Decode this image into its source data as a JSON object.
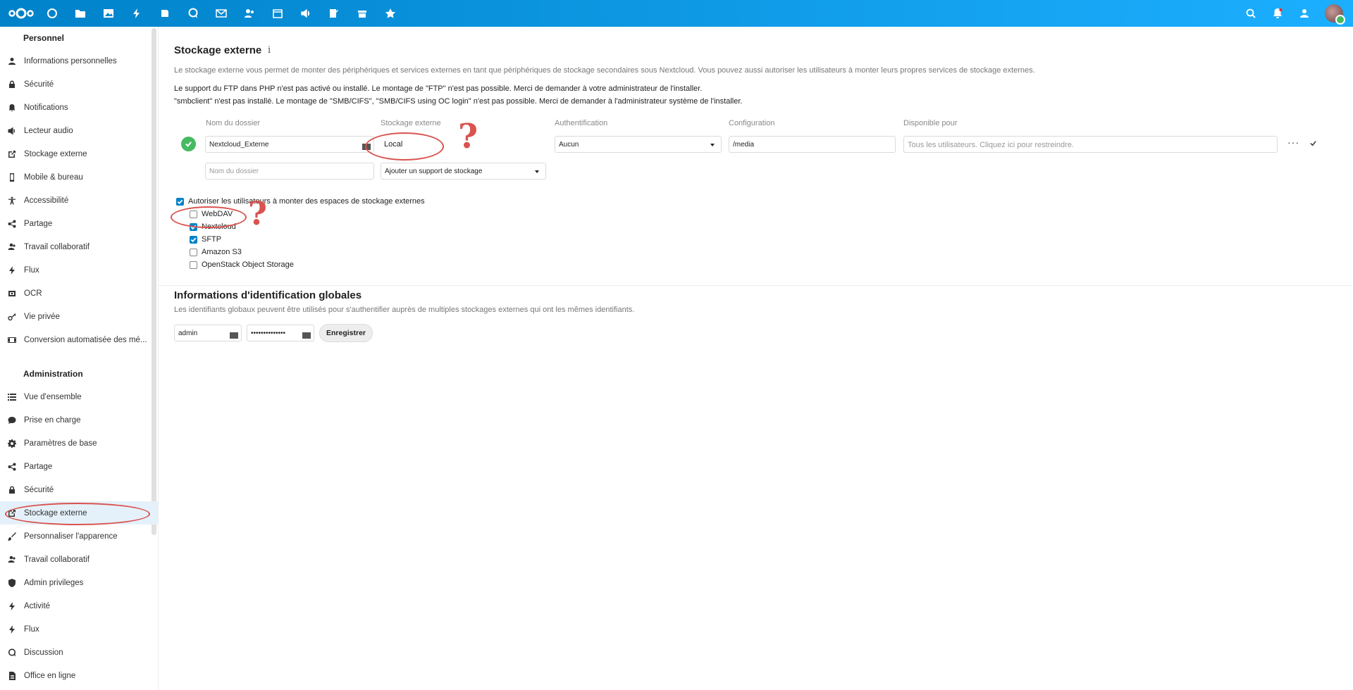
{
  "sidebar": {
    "personal_heading": "Personnel",
    "personal_items": [
      {
        "label": "Informations personnelles",
        "icon": "user-icon"
      },
      {
        "label": "Sécurité",
        "icon": "lock-icon"
      },
      {
        "label": "Notifications",
        "icon": "bell-icon"
      },
      {
        "label": "Lecteur audio",
        "icon": "speaker-icon"
      },
      {
        "label": "Stockage externe",
        "icon": "external-link-icon"
      },
      {
        "label": "Mobile & bureau",
        "icon": "phone-icon"
      },
      {
        "label": "Accessibilité",
        "icon": "accessibility-icon"
      },
      {
        "label": "Partage",
        "icon": "share-icon"
      },
      {
        "label": "Travail collaboratif",
        "icon": "group-icon"
      },
      {
        "label": "Flux",
        "icon": "activity-icon"
      },
      {
        "label": "OCR",
        "icon": "ocr-icon"
      },
      {
        "label": "Vie privée",
        "icon": "key-icon"
      },
      {
        "label": "Conversion automatisée des mé...",
        "icon": "film-icon"
      }
    ],
    "admin_heading": "Administration",
    "admin_items": [
      {
        "label": "Vue d'ensemble",
        "icon": "list-icon"
      },
      {
        "label": "Prise en charge",
        "icon": "chat-icon"
      },
      {
        "label": "Paramètres de base",
        "icon": "gear-icon"
      },
      {
        "label": "Partage",
        "icon": "share-icon"
      },
      {
        "label": "Sécurité",
        "icon": "lock-icon"
      },
      {
        "label": "Stockage externe",
        "icon": "external-link-icon",
        "active": true
      },
      {
        "label": "Personnaliser l'apparence",
        "icon": "brush-icon"
      },
      {
        "label": "Travail collaboratif",
        "icon": "group-icon"
      },
      {
        "label": "Admin privileges",
        "icon": "shield-icon"
      },
      {
        "label": "Activité",
        "icon": "activity-icon"
      },
      {
        "label": "Flux",
        "icon": "activity-icon"
      },
      {
        "label": "Discussion",
        "icon": "talk-icon"
      },
      {
        "label": "Office en ligne",
        "icon": "document-icon"
      }
    ]
  },
  "external": {
    "title": "Stockage externe",
    "info_icon": "info-icon",
    "description": "Le stockage externe vous permet de monter des périphériques et services externes en tant que périphériques de stockage secondaires sous Nextcloud. Vous pouvez aussi autoriser les utilisateurs à monter leurs propres services de stockage externes.",
    "warning_ftp": "Le support du FTP dans PHP n'est pas activé ou installé. Le montage de \"FTP\" n'est pas possible. Merci de demander à votre administrateur de l'installer.",
    "warning_smb": "\"smbclient\" n'est pas installé. Le montage de \"SMB/CIFS\", \"SMB/CIFS using OC login\" n'est pas possible. Merci de demander à l'administrateur système de l'installer.",
    "columns": {
      "folder": "Nom du dossier",
      "storage": "Stockage externe",
      "auth": "Authentification",
      "config": "Configuration",
      "available": "Disponible pour"
    },
    "mount": {
      "folder": "Nextcloud_Externe",
      "storage": "Local",
      "auth": "Aucun",
      "config": "/media",
      "available_placeholder": "Tous les utilisateurs. Cliquez ici pour restreindre."
    },
    "new_row": {
      "folder_placeholder": "Nom du dossier",
      "add_storage": "Ajouter un support de stockage"
    },
    "allow_users_label": "Autoriser les utilisateurs à monter des espaces de stockage externes",
    "allow_users_checked": true,
    "backends": [
      {
        "label": "WebDAV",
        "checked": false
      },
      {
        "label": "Nextcloud",
        "checked": true
      },
      {
        "label": "SFTP",
        "checked": true
      },
      {
        "label": "Amazon S3",
        "checked": false
      },
      {
        "label": "OpenStack Object Storage",
        "checked": false
      }
    ]
  },
  "global_credentials": {
    "title": "Informations d'identification globales",
    "description": "Les identifiants globaux peuvent être utilisés pour s'authentifier auprès de multiples stockages externes qui ont les mêmes identifiants.",
    "username": "admin",
    "password": "••••••••••••••",
    "save_label": "Enregistrer"
  },
  "annotations": {
    "question_mark": "?"
  },
  "colors": {
    "header": "#0082c9",
    "accent": "#0082c9",
    "success": "#46ba61",
    "annotation": "#d9534f"
  }
}
